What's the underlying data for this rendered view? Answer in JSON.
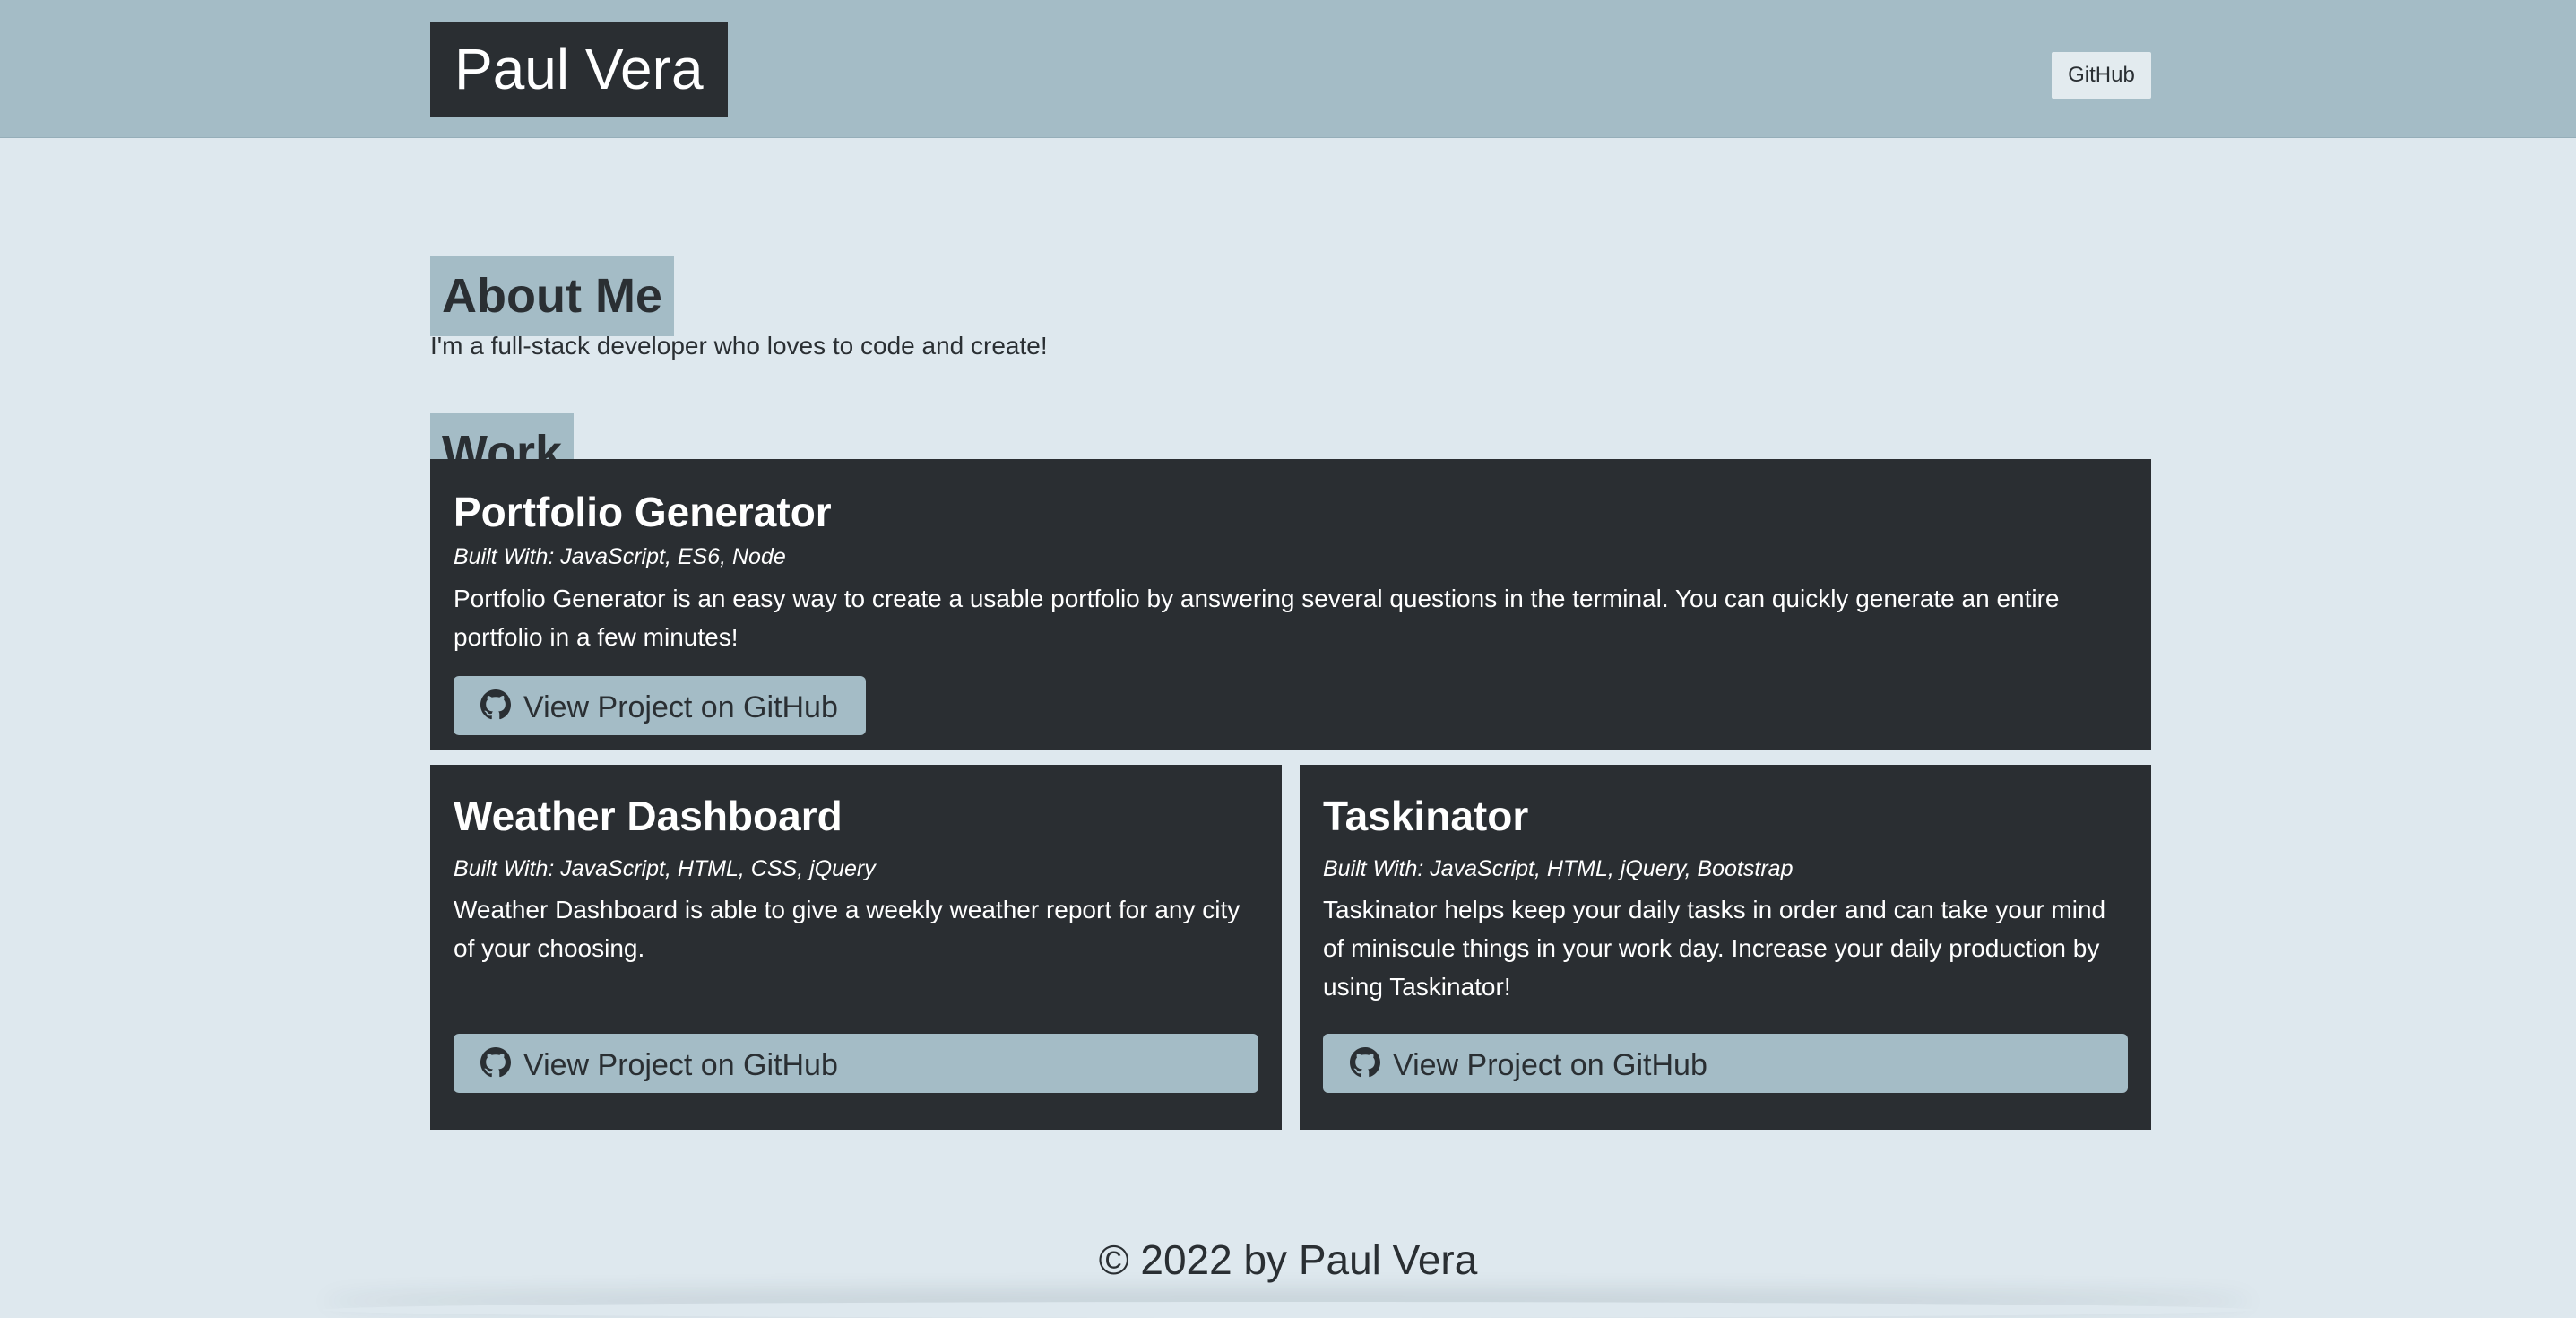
{
  "header": {
    "brand": "Paul Vera",
    "nav_link": "GitHub"
  },
  "about": {
    "heading": "About Me",
    "text": "I'm a full-stack developer who loves to code and create!"
  },
  "work": {
    "heading": "Work",
    "projects": [
      {
        "title": "Portfolio Generator",
        "built_with": "Built With: JavaScript, ES6, Node",
        "description": "Portfolio Generator is an easy way to create a usable portfolio by answering several questions in the terminal. You can quickly generate an entire portfolio in a few minutes!",
        "button_label": "View Project on GitHub",
        "icon": "github-icon"
      },
      {
        "title": "Weather Dashboard",
        "built_with": "Built With: JavaScript, HTML, CSS, jQuery",
        "description": "Weather Dashboard is able to give a weekly weather report for any city of your choosing.",
        "button_label": "View Project on GitHub",
        "icon": "github-icon"
      },
      {
        "title": "Taskinator",
        "built_with": "Built With: JavaScript, HTML, jQuery, Bootstrap",
        "description": "Taskinator helps keep your daily tasks in order and can take your mind of miniscule things in your work day. Increase your daily production by using Taskinator!",
        "button_label": "View Project on GitHub",
        "icon": "github-icon"
      }
    ]
  },
  "footer": {
    "text": "© 2022 by Paul Vera"
  },
  "colors": {
    "page_background": "#dee8ee",
    "header_background": "#a4bcc6",
    "card_background": "#2a2e32",
    "accent": "#a4bcc6",
    "text_dark": "#2a2f33",
    "text_light": "#ffffff"
  }
}
